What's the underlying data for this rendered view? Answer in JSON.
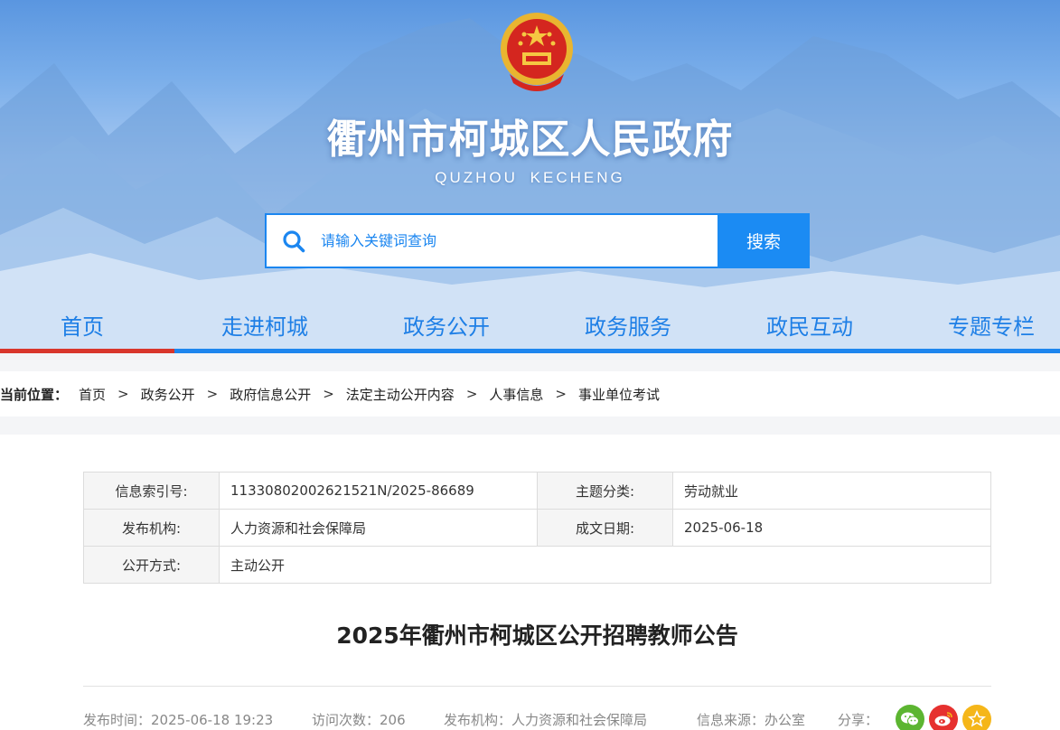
{
  "header": {
    "site_title": "衢州市柯城区人民政府",
    "site_subtitle": "QUZHOU KECHENG"
  },
  "search": {
    "placeholder": "请输入关键词查询",
    "button_label": "搜索"
  },
  "nav": {
    "items": [
      {
        "label": "首页",
        "active": true
      },
      {
        "label": "走进柯城",
        "active": false
      },
      {
        "label": "政务公开",
        "active": false
      },
      {
        "label": "政务服务",
        "active": false
      },
      {
        "label": "政民互动",
        "active": false
      },
      {
        "label": "专题专栏",
        "active": false
      }
    ]
  },
  "breadcrumb": {
    "label": "当前位置：",
    "items": [
      "首页",
      "政务公开",
      "政府信息公开",
      "法定主动公开内容",
      "人事信息",
      "事业单位考试"
    ],
    "separator": ">"
  },
  "info": {
    "index_key": "信息索引号:",
    "index_value": "11330802002621521N/2025-86689",
    "topic_key": "主题分类:",
    "topic_value": "劳动就业",
    "org_key": "发布机构:",
    "org_value": "人力资源和社会保障局",
    "date_key": "成文日期:",
    "date_value": "2025-06-18",
    "mode_key": "公开方式:",
    "mode_value": "主动公开"
  },
  "article": {
    "title": "2025年衢州市柯城区公开招聘教师公告",
    "publish_time": "发布时间：2025-06-18 19:23",
    "visits": "访问次数：206",
    "publisher": "发布机构：人力资源和社会保障局",
    "source": "信息来源：办公室",
    "share_label": "分享："
  },
  "colors": {
    "accent_blue": "#1e86ee",
    "active_red": "#d9362c",
    "wechat_green": "#5cb531",
    "weibo_red": "#e6312f",
    "favorite_gold": "#f5b619"
  },
  "icons": [
    "search-icon",
    "wechat-icon",
    "weibo-icon",
    "star-icon"
  ]
}
